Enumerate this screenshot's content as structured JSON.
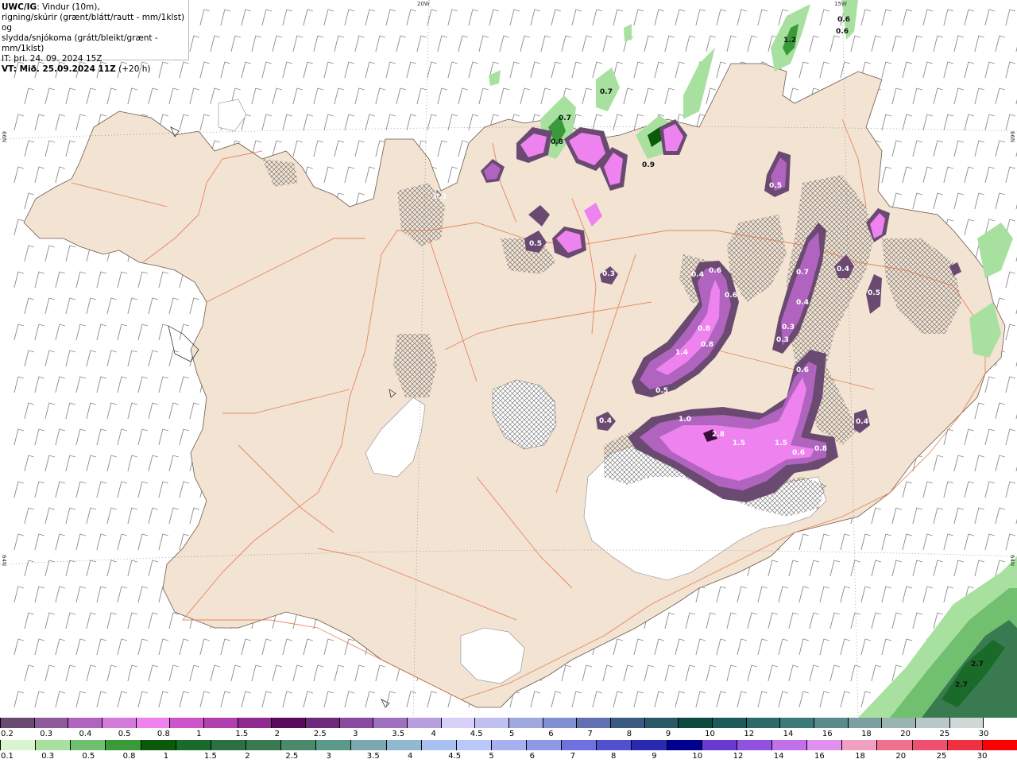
{
  "header": {
    "line1_bold": "UWC/IG",
    "line1_rest": ": Vindur (10m),",
    "line2": "rigning/skúrir (grænt/blátt/rautt - mm/1klst) og",
    "line3": "slydda/snjókoma (grátt/bleikt/grænt - mm/1klst)",
    "line4": "IT: þri. 24. 09. 2024 15Z",
    "line5_bold": "VT: Mið. 25.09.2024 11Z",
    "line5_rest": " (+20 h)"
  },
  "grid_labels": {
    "lon_20w": "20W",
    "lon_15w": "15W",
    "lat_left_66n": "66N",
    "lat_left_64n": "64N",
    "lat_right_66n": "66N",
    "lat_right_64n": "64N"
  },
  "legend_snow": {
    "colors": [
      "#6b4a72",
      "#8e5a9a",
      "#b064c0",
      "#d37ad8",
      "#ee82ee",
      "#cc55cc",
      "#b040b0",
      "#902a90",
      "#5a0a5a",
      "#6e2a7a",
      "#8a4aa0",
      "#a070c0",
      "#b8a0e0",
      "#d8d0f8",
      "#c0c0f0",
      "#a0a8e0",
      "#8090d0",
      "#6070b0",
      "#3a5a80",
      "#2a5868",
      "#0c4a40",
      "#1c5a5a",
      "#2c6a6a",
      "#3c7a7a",
      "#5a8a8a",
      "#7aa0a0",
      "#9ab4b4",
      "#b8c8c8",
      "#d0d8d8",
      "#ffffff"
    ],
    "labels": [
      "0.2",
      "0.3",
      "0.4",
      "0.5",
      "0.8",
      "1",
      "1.5",
      "2",
      "2.5",
      "3",
      "3.5",
      "4",
      "4.5",
      "5",
      "6",
      "7",
      "8",
      "9",
      "10",
      "12",
      "14",
      "16",
      "18",
      "20",
      "25",
      "30"
    ]
  },
  "legend_rain": {
    "colors": [
      "#d8f5d0",
      "#a8e0a0",
      "#70c070",
      "#3a9a3a",
      "#0a5a0a",
      "#1a6a2a",
      "#2a7040",
      "#3a7a50",
      "#4a8a6a",
      "#5a9a8a",
      "#7aa8b0",
      "#90b8d0",
      "#a8c0f0",
      "#b8c8f8",
      "#a8b0f0",
      "#9098e8",
      "#7070e0",
      "#5050d0",
      "#2a2ab0",
      "#000090",
      "#6a3ad0",
      "#9050e0",
      "#c070e8",
      "#e090f0",
      "#f0a0c0",
      "#f07090",
      "#f05070",
      "#f03040",
      "#ff0000"
    ],
    "labels": [
      "0.1",
      "0.3",
      "0.5",
      "0.8",
      "1",
      "1.5",
      "2",
      "2.5",
      "3",
      "3.5",
      "4",
      "4.5",
      "5",
      "6",
      "7",
      "8",
      "9",
      "10",
      "12",
      "14",
      "16",
      "18",
      "20",
      "25",
      "30"
    ]
  },
  "precip_values": [
    {
      "v": "0.6"
    },
    {
      "v": "0.6"
    },
    {
      "v": "1.2"
    },
    {
      "v": "0.7"
    },
    {
      "v": "0.7"
    },
    {
      "v": "0.8"
    },
    {
      "v": "0.9"
    },
    {
      "v": "0.5"
    },
    {
      "v": "0.3"
    },
    {
      "v": "0.5"
    },
    {
      "v": "0.3"
    },
    {
      "v": "0.4"
    },
    {
      "v": "0.6"
    },
    {
      "v": "0.8"
    },
    {
      "v": "0.6"
    },
    {
      "v": "1.4"
    },
    {
      "v": "0.8"
    },
    {
      "v": "0.5"
    },
    {
      "v": "0.7"
    },
    {
      "v": "0.4"
    },
    {
      "v": "0.3"
    },
    {
      "v": "0.3"
    },
    {
      "v": "0.6"
    },
    {
      "v": "0.4"
    },
    {
      "v": "0.5"
    },
    {
      "v": "0.4"
    },
    {
      "v": "1.0"
    },
    {
      "v": "2.8"
    },
    {
      "v": "1.5"
    },
    {
      "v": "1.5"
    },
    {
      "v": "0.6"
    },
    {
      "v": "0.8"
    },
    {
      "v": "0.4"
    },
    {
      "v": "2.7"
    },
    {
      "v": "2.7"
    }
  ]
}
